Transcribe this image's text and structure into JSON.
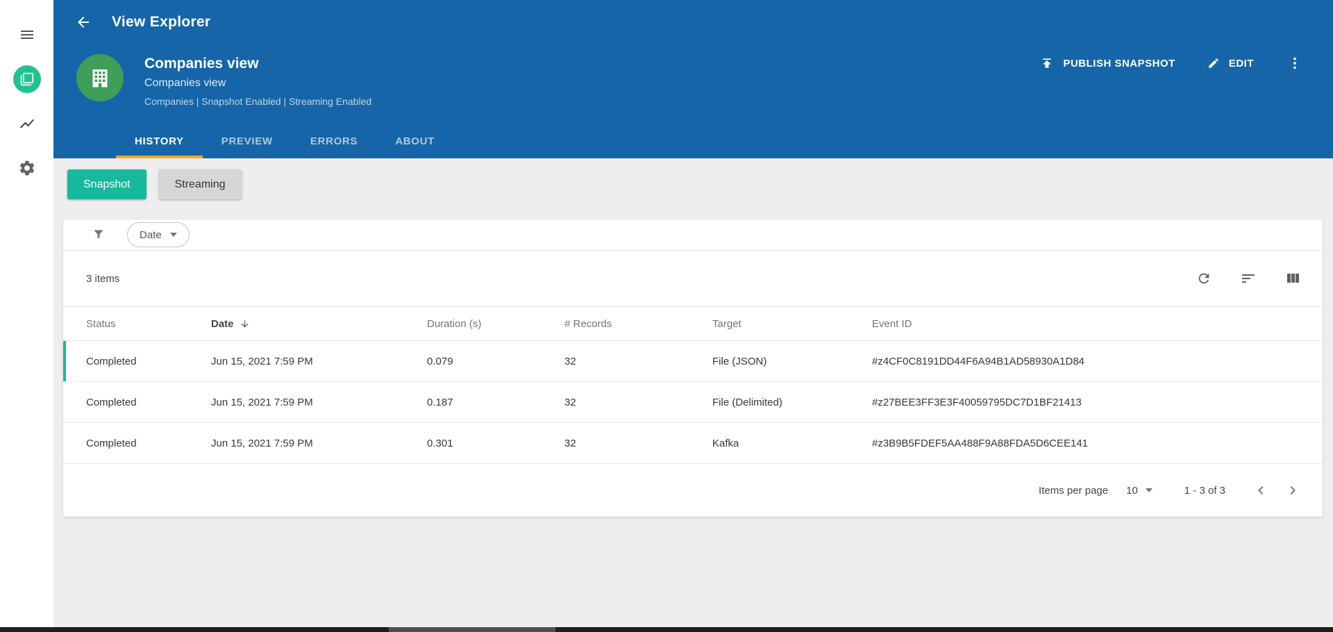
{
  "colors": {
    "header_blue": "#1665a8",
    "accent_teal": "#16b99b",
    "tab_underline_yellow": "#f9a825",
    "avatar_green": "#3f9e58",
    "sidebar_icon_green": "#22c28f"
  },
  "icons": [
    "menu-icon",
    "views-icon",
    "chart-icon",
    "settings-gear-icon",
    "back-arrow-icon",
    "building-avatar-icon",
    "publish-upload-icon",
    "edit-pencil-icon",
    "kebab-menu-icon",
    "filter-funnel-icon",
    "chevron-down-icon",
    "refresh-icon",
    "sort-lines-icon",
    "columns-icon",
    "sort-arrow-down-icon",
    "chevron-left-icon",
    "chevron-right-icon"
  ],
  "topbar": {
    "title": "View Explorer"
  },
  "header": {
    "title": "Companies view",
    "subtitle": "Companies view",
    "meta": "Companies | Snapshot Enabled | Streaming Enabled",
    "actions": {
      "publish": "PUBLISH SNAPSHOT",
      "edit": "EDIT"
    },
    "tabs": [
      {
        "label": "HISTORY",
        "active": true
      },
      {
        "label": "PREVIEW",
        "active": false
      },
      {
        "label": "ERRORS",
        "active": false
      },
      {
        "label": "ABOUT",
        "active": false
      }
    ]
  },
  "toggles": [
    {
      "label": "Snapshot",
      "active": true
    },
    {
      "label": "Streaming",
      "active": false
    }
  ],
  "filter": {
    "chip_label": "Date"
  },
  "table": {
    "count_label": "3 items",
    "columns": [
      "Status",
      "Date",
      "Duration (s)",
      "# Records",
      "Target",
      "Event ID"
    ],
    "sorted_by": "Date",
    "sort_direction": "desc",
    "rows": [
      {
        "status": "Completed",
        "date": "Jun 15, 2021 7:59 PM",
        "duration": "0.079",
        "records": "32",
        "target": "File (JSON)",
        "event_id": "#z4CF0C8191DD44F6A94B1AD58930A1D84"
      },
      {
        "status": "Completed",
        "date": "Jun 15, 2021 7:59 PM",
        "duration": "0.187",
        "records": "32",
        "target": "File (Delimited)",
        "event_id": "#z27BEE3FF3E3F40059795DC7D1BF21413"
      },
      {
        "status": "Completed",
        "date": "Jun 15, 2021 7:59 PM",
        "duration": "0.301",
        "records": "32",
        "target": "Kafka",
        "event_id": "#z3B9B5FDEF5AA488F9A88FDA5D6CEE141"
      }
    ]
  },
  "pagination": {
    "items_per_page_label": "Items per page",
    "items_per_page_value": "10",
    "range_label": "1 - 3 of 3"
  }
}
